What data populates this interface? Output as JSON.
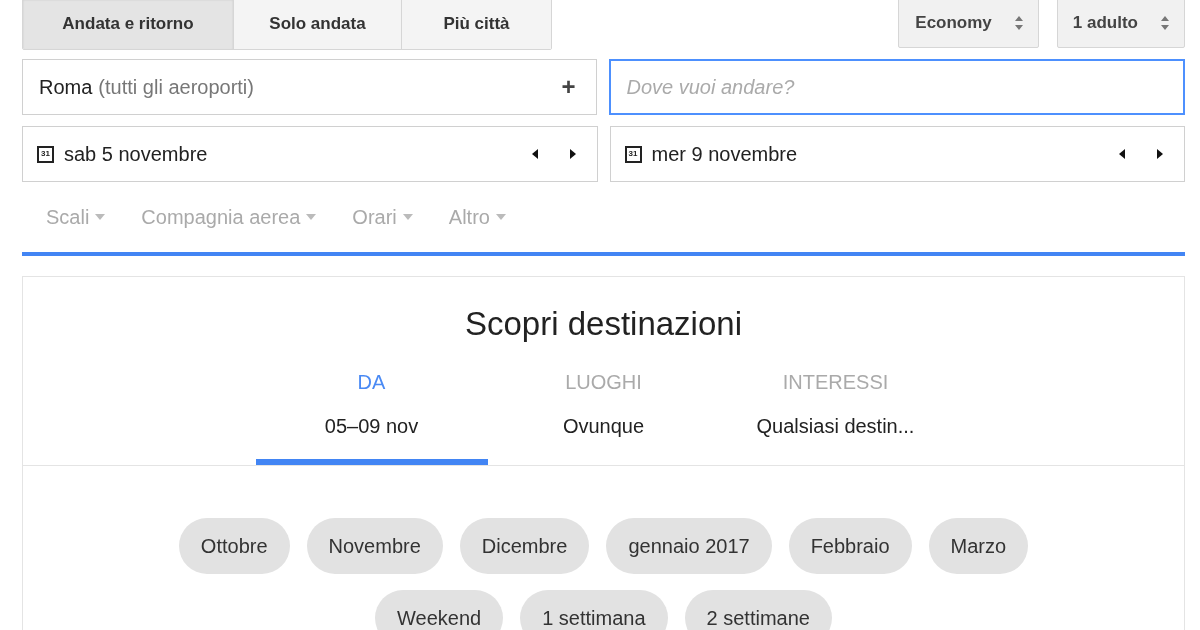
{
  "trip_types": [
    {
      "label": "Andata e ritorno",
      "selected": true
    },
    {
      "label": "Solo andata",
      "selected": false
    },
    {
      "label": "Più città",
      "selected": false
    }
  ],
  "selects": [
    {
      "value": "Economy"
    },
    {
      "value": "1 adulto"
    }
  ],
  "origin": {
    "value": "Roma",
    "hint": "(tutti gli aeroporti)",
    "add": "+"
  },
  "destination": {
    "placeholder": "Dove vuoi andare?",
    "focused": true
  },
  "dates": [
    {
      "icon_label": "31",
      "value": "sab 5 novembre"
    },
    {
      "icon_label": "31",
      "value": "mer 9 novembre"
    }
  ],
  "filters": [
    "Scali",
    "Compagnia aerea",
    "Orari",
    "Altro"
  ],
  "explore": {
    "title": "Scopri destinazioni",
    "tabs": [
      {
        "label": "DA",
        "value": "05–09 nov",
        "selected": true
      },
      {
        "label": "LUOGHI",
        "value": "Ovunque",
        "selected": false
      },
      {
        "label": "INTERESSI",
        "value": "Qualsiasi destin...",
        "selected": false
      }
    ],
    "chip_rows": [
      [
        "Ottobre",
        "Novembre",
        "Dicembre",
        "gennaio 2017",
        "Febbraio",
        "Marzo"
      ],
      [
        "Weekend",
        "1 settimana",
        "2 settimane"
      ]
    ]
  }
}
